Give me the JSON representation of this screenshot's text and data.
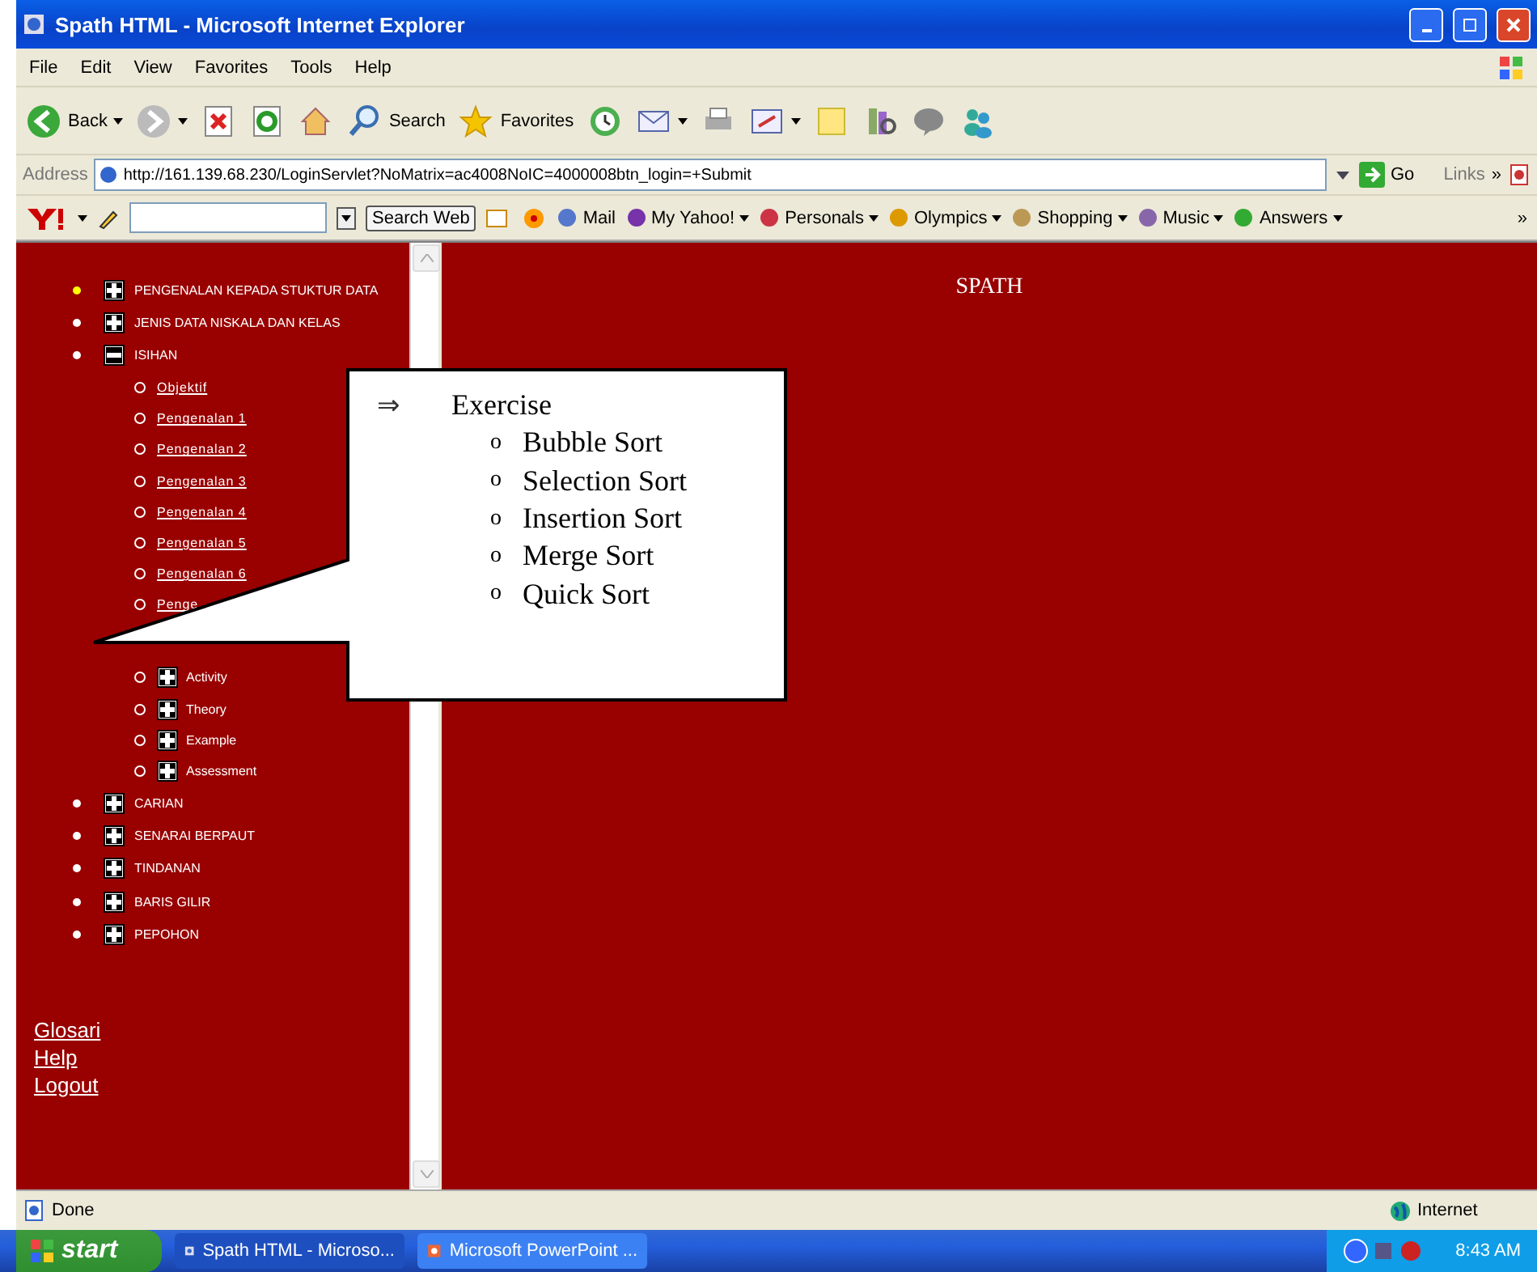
{
  "window": {
    "title": "Spath HTML - Microsoft Internet Explorer"
  },
  "menu": [
    "File",
    "Edit",
    "View",
    "Favorites",
    "Tools",
    "Help"
  ],
  "toolbar": [
    {
      "kind": "back",
      "label": "Back"
    },
    {
      "kind": "forward"
    },
    {
      "kind": "stop"
    },
    {
      "kind": "refresh"
    },
    {
      "kind": "home"
    },
    {
      "kind": "search",
      "label": "Search"
    },
    {
      "kind": "favorites",
      "label": "Favorites"
    },
    {
      "kind": "history"
    },
    {
      "kind": "mail"
    },
    {
      "kind": "print"
    },
    {
      "kind": "edit"
    },
    {
      "kind": "note"
    },
    {
      "kind": "research"
    },
    {
      "kind": "discuss"
    },
    {
      "kind": "messenger"
    }
  ],
  "address": {
    "label": "Address",
    "url": "http://161.139.68.230/LoginServlet?NoMatrix=ac4008NoIC=4000008btn_login=+Submit",
    "go": "Go",
    "links": "Links",
    "more": "»"
  },
  "yahoo_bar": {
    "search_button": "Search Web",
    "items": [
      "Mail",
      "My Yahoo!",
      "Personals",
      "Olympics",
      "Shopping",
      "Music",
      "Answers"
    ],
    "more": "»"
  },
  "sidebar": {
    "items": [
      {
        "label": "PENGENALAN KEPADA STUKTUR DATA",
        "selected": true,
        "expanded": false
      },
      {
        "label": "JENIS DATA NISKALA DAN KELAS",
        "selected": false,
        "expanded": false
      },
      {
        "label": "ISIHAN",
        "selected": false,
        "expanded": true,
        "children": [
          {
            "kind": "link",
            "label": "Objektif"
          },
          {
            "kind": "link",
            "label": "Pengenalan 1"
          },
          {
            "kind": "link",
            "label": "Pengenalan 2"
          },
          {
            "kind": "link",
            "label": "Pengenalan 3"
          },
          {
            "kind": "link",
            "label": "Pengenalan 4"
          },
          {
            "kind": "link",
            "label": "Pengenalan 5"
          },
          {
            "kind": "link",
            "label": "Pengenalan 6"
          },
          {
            "kind": "link",
            "label": "Penge"
          },
          {
            "kind": "section",
            "label": "Activity"
          },
          {
            "kind": "section",
            "label": "Theory"
          },
          {
            "kind": "section",
            "label": "Example"
          },
          {
            "kind": "section",
            "label": "Assessment"
          }
        ]
      },
      {
        "label": "CARIAN",
        "selected": false,
        "expanded": false
      },
      {
        "label": "SENARAI BERPAUT",
        "selected": false,
        "expanded": false
      },
      {
        "label": "TINDANAN",
        "selected": false,
        "expanded": false
      },
      {
        "label": "BARIS GILIR",
        "selected": false,
        "expanded": false
      },
      {
        "label": "PEPOHON",
        "selected": false,
        "expanded": false
      }
    ],
    "links": [
      "Glosari",
      "Help",
      "Logout"
    ]
  },
  "main": {
    "heading": "SPATH"
  },
  "callout": {
    "arrow": "⇒",
    "title": "Exercise",
    "items": [
      {
        "bullet": "o",
        "label": "Bubble Sort"
      },
      {
        "bullet": "o",
        "label": "Selection Sort"
      },
      {
        "bullet": "o",
        "label": "Insertion Sort"
      },
      {
        "bullet": "o",
        "label": "Merge Sort"
      },
      {
        "bullet": "o",
        "label": "Quick Sort"
      }
    ]
  },
  "status_bar": {
    "text": "Done",
    "zone": "Internet"
  },
  "taskbar": {
    "start": "start",
    "tasks": [
      {
        "label": "Spath HTML - Microso...",
        "selected": true
      },
      {
        "label": "Microsoft PowerPoint ...",
        "selected": false
      }
    ],
    "clock": "8:43 AM"
  }
}
